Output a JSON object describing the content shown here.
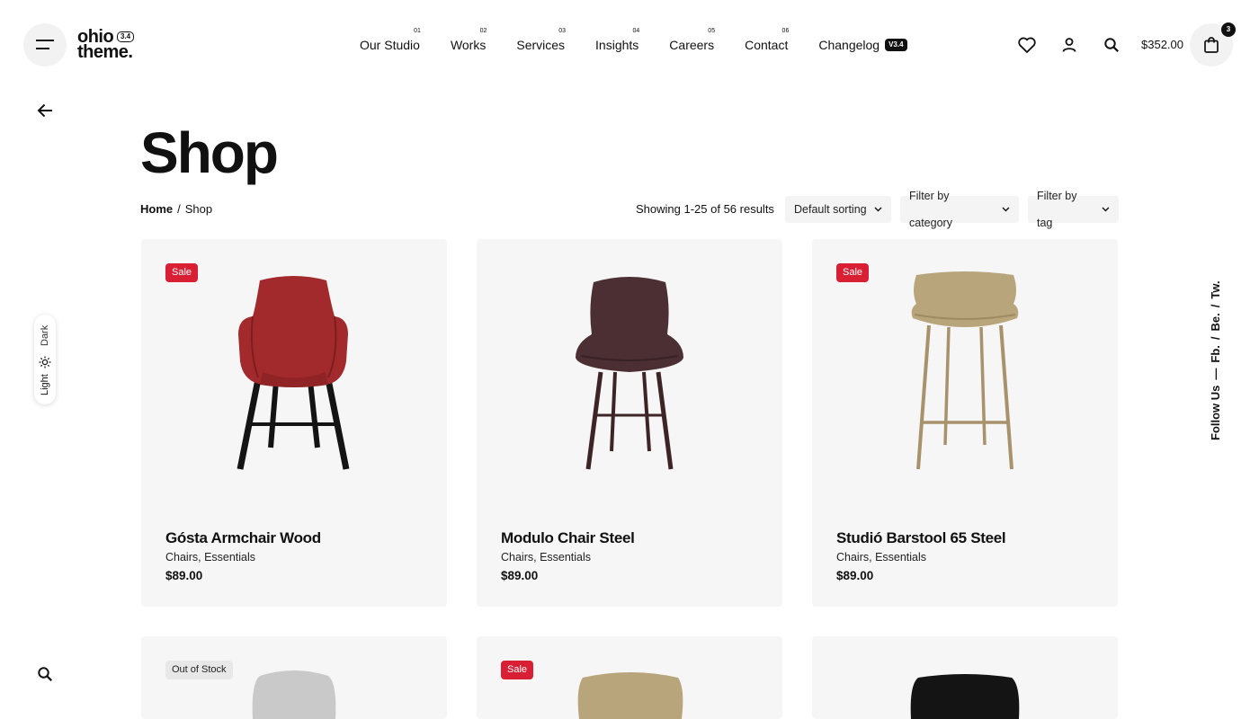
{
  "brand": {
    "logo_line1": "ohio",
    "logo_line2": "theme.",
    "logo_version": "3.4"
  },
  "nav": [
    {
      "label": "Our Studio",
      "num": "01"
    },
    {
      "label": "Works",
      "num": "02"
    },
    {
      "label": "Services",
      "num": "03"
    },
    {
      "label": "Insights",
      "num": "04"
    },
    {
      "label": "Careers",
      "num": "05"
    },
    {
      "label": "Contact",
      "num": "06"
    },
    {
      "label": "Changelog",
      "badge": "V3.4"
    }
  ],
  "header": {
    "cart_total": "$352.00",
    "cart_count": "3"
  },
  "theme_toggle": {
    "dark_label": "Dark",
    "light_label": "Light"
  },
  "follow": {
    "label": "Follow Us",
    "dash": "—",
    "links": [
      "Fb.",
      "Be.",
      "Tw."
    ],
    "sep": "/"
  },
  "page": {
    "title": "Shop",
    "breadcrumb": {
      "home": "Home",
      "sep": "/",
      "current": "Shop"
    },
    "results_text": "Showing 1-25 of 56 results",
    "sorting": "Default sorting",
    "filter_category": "Filter by category",
    "filter_tag": "Filter by tag"
  },
  "products": [
    {
      "name": "Gósta Armchair Wood",
      "categories": "Chairs, Essentials",
      "price": "$89.00",
      "badge": "Sale"
    },
    {
      "name": "Modulo Chair Steel",
      "categories": "Chairs, Essentials",
      "price": "$89.00",
      "badge": ""
    },
    {
      "name": "Studió Barstool 65 Steel",
      "categories": "Chairs, Essentials",
      "price": "$89.00",
      "badge": "Sale"
    },
    {
      "name": "",
      "categories": "",
      "price": "",
      "badge": "Out of Stock"
    },
    {
      "name": "",
      "categories": "",
      "price": "",
      "badge": "Sale"
    },
    {
      "name": "",
      "categories": "",
      "price": "",
      "badge": ""
    }
  ],
  "colors": {
    "sale": "#d81f33",
    "card_bg": "#f6f6f6",
    "text": "#111111"
  },
  "icons": [
    "menu-icon",
    "heart-icon",
    "user-icon",
    "search-icon",
    "bag-icon",
    "arrow-left-icon",
    "sun-icon",
    "chevron-down-icon"
  ]
}
